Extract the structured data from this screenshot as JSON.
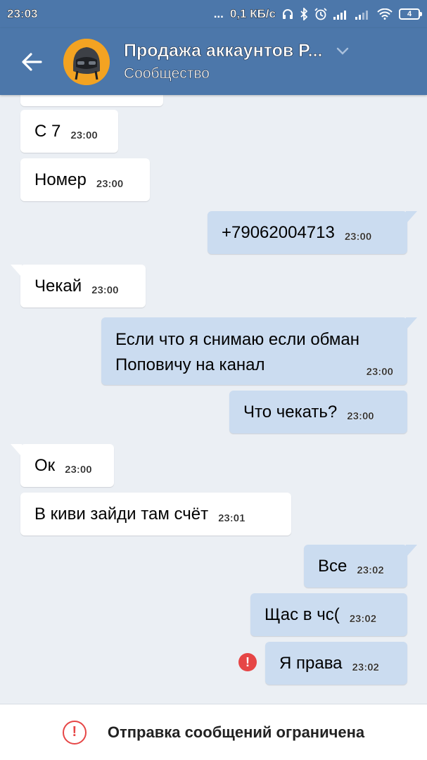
{
  "status_bar": {
    "time": "23:03",
    "dots": "...",
    "speed": "0,1 КБ/с",
    "battery": "4"
  },
  "header": {
    "title": "Продажа аккаунтов P...",
    "subtitle": "Сообщество",
    "accent_color": "#4c77aa"
  },
  "messages": [
    {
      "text": "С 7",
      "time": "23:00",
      "direction": "in"
    },
    {
      "text": "Номер",
      "time": "23:00",
      "direction": "in"
    },
    {
      "text": "+79062004713",
      "time": "23:00",
      "direction": "out"
    },
    {
      "text": "Чекай",
      "time": "23:00",
      "direction": "in"
    },
    {
      "line1": "Если что я снимаю если обман",
      "line2": "Поповичу на канал",
      "time": "23:00",
      "direction": "out"
    },
    {
      "text": "Что чекать?",
      "time": "23:00",
      "direction": "out"
    },
    {
      "text": "Ок",
      "time": "23:00",
      "direction": "in"
    },
    {
      "text": "В киви зайди там счёт",
      "time": "23:01",
      "direction": "in"
    },
    {
      "text": "Все",
      "time": "23:02",
      "direction": "out"
    },
    {
      "text": "Щас в чс(",
      "time": "23:02",
      "direction": "out"
    },
    {
      "text": "Я права",
      "time": "23:02",
      "direction": "out",
      "error_mark": "!"
    }
  ],
  "bottom_bar": {
    "icon": "!",
    "notice": "Отправка сообщений ограничена",
    "alert_color": "#e64646"
  }
}
